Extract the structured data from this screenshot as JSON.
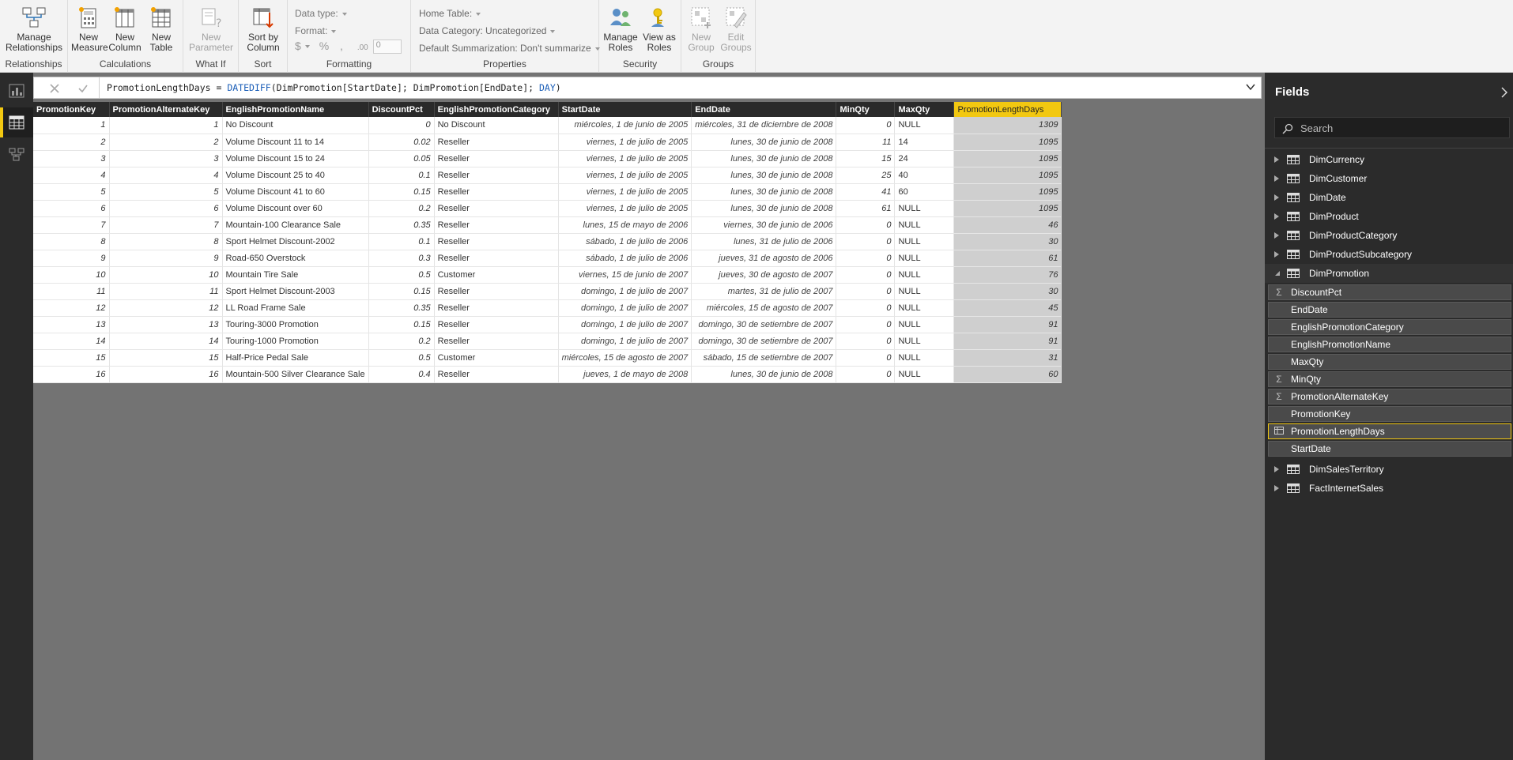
{
  "ribbon": {
    "groups": {
      "relationships": "Relationships",
      "calculations": "Calculations",
      "whatif": "What If",
      "sort": "Sort",
      "formatting": "Formatting",
      "properties": "Properties",
      "security": "Security",
      "groups": "Groups"
    },
    "buttons": {
      "manage_relationships": "Manage\nRelationships",
      "new_measure": "New\nMeasure",
      "new_column": "New\nColumn",
      "new_table": "New\nTable",
      "new_parameter": "New\nParameter",
      "sort_by_column": "Sort by\nColumn",
      "manage_roles": "Manage\nRoles",
      "view_as_roles": "View as\nRoles",
      "new_group": "New\nGroup",
      "edit_groups": "Edit\nGroups"
    },
    "formatting": {
      "data_type": "Data type:",
      "format": "Format:",
      "currency": "$",
      "percent": "%",
      "comma": ",",
      "decimal_places": "0"
    },
    "properties": {
      "home_table": "Home Table:",
      "data_category": "Data Category: Uncategorized",
      "default_summarization": "Default Summarization: Don't summarize"
    }
  },
  "formula": {
    "prefix": "PromotionLengthDays = ",
    "function": "DATEDIFF",
    "args": "(DimPromotion[StartDate]; DimPromotion[EndDate]; ",
    "unit": "DAY",
    "suffix": ")"
  },
  "table": {
    "columns": [
      "PromotionKey",
      "PromotionAlternateKey",
      "EnglishPromotionName",
      "DiscountPct",
      "EnglishPromotionCategory",
      "StartDate",
      "EndDate",
      "MinQty",
      "MaxQty",
      "PromotionLengthDays"
    ],
    "rows": [
      [
        "1",
        "1",
        "No Discount",
        "0",
        "No Discount",
        "miércoles, 1 de junio de 2005",
        "miércoles, 31 de diciembre de 2008",
        "0",
        "NULL",
        "1309"
      ],
      [
        "2",
        "2",
        "Volume Discount 11 to 14",
        "0.02",
        "Reseller",
        "viernes, 1 de julio de 2005",
        "lunes, 30 de junio de 2008",
        "11",
        "14",
        "1095"
      ],
      [
        "3",
        "3",
        "Volume Discount 15 to 24",
        "0.05",
        "Reseller",
        "viernes, 1 de julio de 2005",
        "lunes, 30 de junio de 2008",
        "15",
        "24",
        "1095"
      ],
      [
        "4",
        "4",
        "Volume Discount 25 to 40",
        "0.1",
        "Reseller",
        "viernes, 1 de julio de 2005",
        "lunes, 30 de junio de 2008",
        "25",
        "40",
        "1095"
      ],
      [
        "5",
        "5",
        "Volume Discount 41 to 60",
        "0.15",
        "Reseller",
        "viernes, 1 de julio de 2005",
        "lunes, 30 de junio de 2008",
        "41",
        "60",
        "1095"
      ],
      [
        "6",
        "6",
        "Volume Discount over 60",
        "0.2",
        "Reseller",
        "viernes, 1 de julio de 2005",
        "lunes, 30 de junio de 2008",
        "61",
        "NULL",
        "1095"
      ],
      [
        "7",
        "7",
        "Mountain-100 Clearance Sale",
        "0.35",
        "Reseller",
        "lunes, 15 de mayo de 2006",
        "viernes, 30 de junio de 2006",
        "0",
        "NULL",
        "46"
      ],
      [
        "8",
        "8",
        "Sport Helmet Discount-2002",
        "0.1",
        "Reseller",
        "sábado, 1 de julio de 2006",
        "lunes, 31 de julio de 2006",
        "0",
        "NULL",
        "30"
      ],
      [
        "9",
        "9",
        "Road-650 Overstock",
        "0.3",
        "Reseller",
        "sábado, 1 de julio de 2006",
        "jueves, 31 de agosto de 2006",
        "0",
        "NULL",
        "61"
      ],
      [
        "10",
        "10",
        "Mountain Tire Sale",
        "0.5",
        "Customer",
        "viernes, 15 de junio de 2007",
        "jueves, 30 de agosto de 2007",
        "0",
        "NULL",
        "76"
      ],
      [
        "11",
        "11",
        "Sport Helmet Discount-2003",
        "0.15",
        "Reseller",
        "domingo, 1 de julio de 2007",
        "martes, 31 de julio de 2007",
        "0",
        "NULL",
        "30"
      ],
      [
        "12",
        "12",
        "LL Road Frame Sale",
        "0.35",
        "Reseller",
        "domingo, 1 de julio de 2007",
        "miércoles, 15 de agosto de 2007",
        "0",
        "NULL",
        "45"
      ],
      [
        "13",
        "13",
        "Touring-3000 Promotion",
        "0.15",
        "Reseller",
        "domingo, 1 de julio de 2007",
        "domingo, 30 de setiembre de 2007",
        "0",
        "NULL",
        "91"
      ],
      [
        "14",
        "14",
        "Touring-1000 Promotion",
        "0.2",
        "Reseller",
        "domingo, 1 de julio de 2007",
        "domingo, 30 de setiembre de 2007",
        "0",
        "NULL",
        "91"
      ],
      [
        "15",
        "15",
        "Half-Price Pedal Sale",
        "0.5",
        "Customer",
        "miércoles, 15 de agosto de 2007",
        "sábado, 15 de setiembre de 2007",
        "0",
        "NULL",
        "31"
      ],
      [
        "16",
        "16",
        "Mountain-500 Silver Clearance Sale",
        "0.4",
        "Reseller",
        "jueves, 1 de mayo de 2008",
        "lunes, 30 de junio de 2008",
        "0",
        "NULL",
        "60"
      ]
    ]
  },
  "fields_pane": {
    "title": "Fields",
    "search_placeholder": "Search",
    "tables_before": [
      "DimCurrency",
      "DimCustomer",
      "DimDate",
      "DimProduct",
      "DimProductCategory",
      "DimProductSubcategory"
    ],
    "expanded_table": "DimPromotion",
    "expanded_fields": [
      {
        "name": "DiscountPct",
        "icon": "sigma"
      },
      {
        "name": "EndDate",
        "icon": "none"
      },
      {
        "name": "EnglishPromotionCategory",
        "icon": "none"
      },
      {
        "name": "EnglishPromotionName",
        "icon": "none"
      },
      {
        "name": "MaxQty",
        "icon": "none"
      },
      {
        "name": "MinQty",
        "icon": "sigma"
      },
      {
        "name": "PromotionAlternateKey",
        "icon": "sigma"
      },
      {
        "name": "PromotionKey",
        "icon": "none"
      },
      {
        "name": "PromotionLengthDays",
        "icon": "calculated-column",
        "selected": true
      },
      {
        "name": "StartDate",
        "icon": "none"
      }
    ],
    "tables_after": [
      "DimSalesTerritory",
      "FactInternetSales"
    ]
  },
  "colors": {
    "accent": "#f2c811",
    "ribbon_bg": "#f3f3f3",
    "canvas_bg": "#737373",
    "pane_bg": "#2b2b2b",
    "dax_function": "#1c5fb8"
  }
}
